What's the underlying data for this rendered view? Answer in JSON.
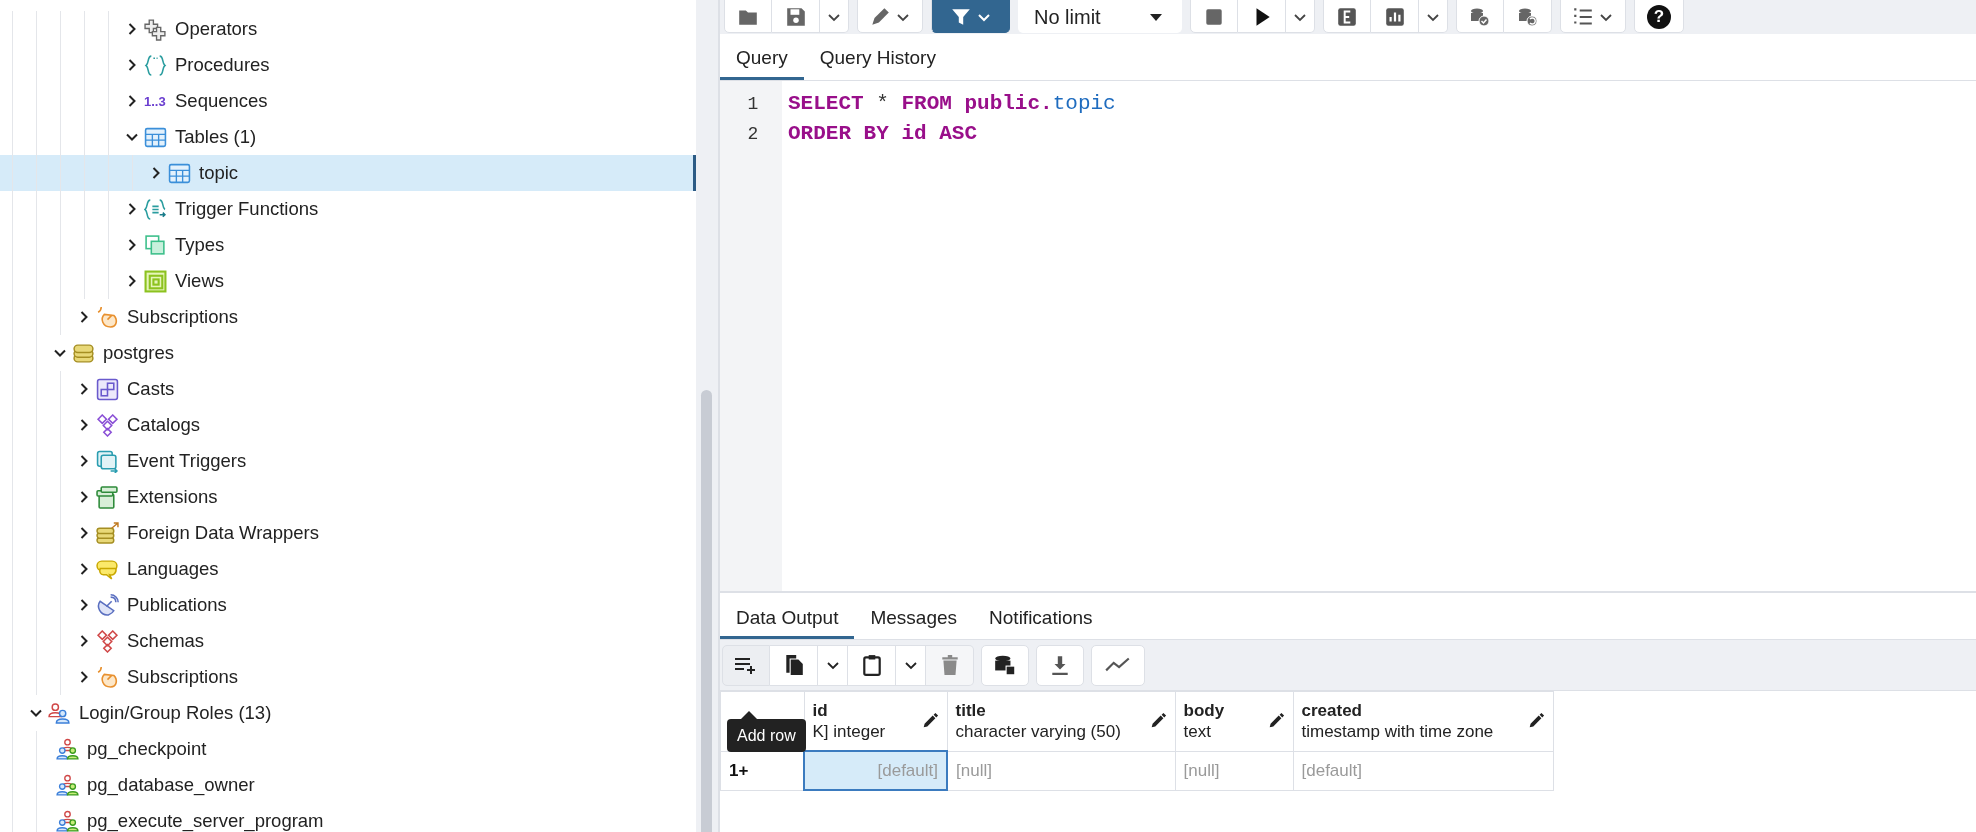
{
  "tree": [
    {
      "children": [
        {
          "children": [
            {
              "children": [
                {
                  "children": [
                    {
                      "children": [
                        {
                          "label": "Operators",
                          "kind": "operator",
                          "expanded": false,
                          "selected": false
                        },
                        {
                          "label": "Procedures",
                          "kind": "procedure",
                          "expanded": false,
                          "selected": false
                        },
                        {
                          "label": "Sequences",
                          "kind": "sequence",
                          "icon_text": "1..3",
                          "expanded": false,
                          "selected": false
                        },
                        {
                          "label": "Tables (1)",
                          "kind": "table",
                          "expanded": true,
                          "selected": false,
                          "children": [
                            {
                              "label": "topic",
                              "kind": "table",
                              "expanded": false,
                              "selected": true
                            }
                          ]
                        },
                        {
                          "label": "Trigger Functions",
                          "kind": "trigger-function",
                          "expanded": false,
                          "selected": false
                        },
                        {
                          "label": "Types",
                          "kind": "type",
                          "expanded": false,
                          "selected": false
                        },
                        {
                          "label": "Views",
                          "kind": "view",
                          "expanded": false,
                          "selected": false
                        }
                      ]
                    }
                  ]
                },
                {
                  "label": "Subscriptions",
                  "kind": "subscription",
                  "expanded": false,
                  "selected": false
                }
              ]
            },
            {
              "label": "postgres",
              "kind": "database",
              "expanded": true,
              "selected": false,
              "children": [
                {
                  "label": "Casts",
                  "kind": "cast",
                  "expanded": false,
                  "selected": false
                },
                {
                  "label": "Catalogs",
                  "kind": "catalog",
                  "expanded": false,
                  "selected": false
                },
                {
                  "label": "Event Triggers",
                  "kind": "event-trigger",
                  "expanded": false,
                  "selected": false
                },
                {
                  "label": "Extensions",
                  "kind": "extension",
                  "expanded": false,
                  "selected": false
                },
                {
                  "label": "Foreign Data Wrappers",
                  "kind": "fdw",
                  "expanded": false,
                  "selected": false
                },
                {
                  "label": "Languages",
                  "kind": "language",
                  "expanded": false,
                  "selected": false
                },
                {
                  "label": "Publications",
                  "kind": "publication",
                  "expanded": false,
                  "selected": false
                },
                {
                  "label": "Schemas",
                  "kind": "schema",
                  "expanded": false,
                  "selected": false
                },
                {
                  "label": "Subscriptions",
                  "kind": "subscription",
                  "expanded": false,
                  "selected": false
                }
              ]
            }
          ]
        },
        {
          "label": "Login/Group Roles (13)",
          "kind": "role-group",
          "expanded": true,
          "selected": false,
          "children": [
            {
              "label": "pg_checkpoint",
              "kind": "role",
              "selected": false
            },
            {
              "label": "pg_database_owner",
              "kind": "role",
              "selected": false
            },
            {
              "label": "pg_execute_server_program",
              "kind": "role",
              "selected": false
            }
          ]
        }
      ]
    }
  ],
  "toolbar": {
    "limit": "No limit",
    "help": "?"
  },
  "query_tabs": [
    {
      "label": "Query",
      "selected": true
    },
    {
      "label": "Query History",
      "selected": false
    }
  ],
  "editor": {
    "lines": [
      {
        "number": "1",
        "tokens": [
          {
            "text": "SELECT",
            "kind": "keyword"
          },
          {
            "text": " * ",
            "kind": "plain"
          },
          {
            "text": "FROM public.",
            "kind": "keyword"
          },
          {
            "text": "topic",
            "kind": "name"
          }
        ]
      },
      {
        "number": "2",
        "tokens": [
          {
            "text": "ORDER BY id ASC",
            "kind": "keyword"
          }
        ]
      }
    ]
  },
  "result_tabs": [
    {
      "label": "Data Output",
      "selected": true
    },
    {
      "label": "Messages",
      "selected": false
    },
    {
      "label": "Notifications",
      "selected": false
    }
  ],
  "tooltip": "Add row",
  "grid": {
    "columns": [
      {
        "name": "id",
        "type": "K] integer"
      },
      {
        "name": "title",
        "type": "character varying (50)"
      },
      {
        "name": "body",
        "type": "text"
      },
      {
        "name": "created",
        "type": "timestamp with time zone"
      }
    ],
    "rows": [
      {
        "label": "1+",
        "cells": [
          {
            "value": "[default]",
            "selected": true
          },
          {
            "value": "[null]",
            "selected": false
          },
          {
            "value": "[null]",
            "selected": false
          },
          {
            "value": "[default]",
            "selected": false
          }
        ]
      }
    ]
  }
}
